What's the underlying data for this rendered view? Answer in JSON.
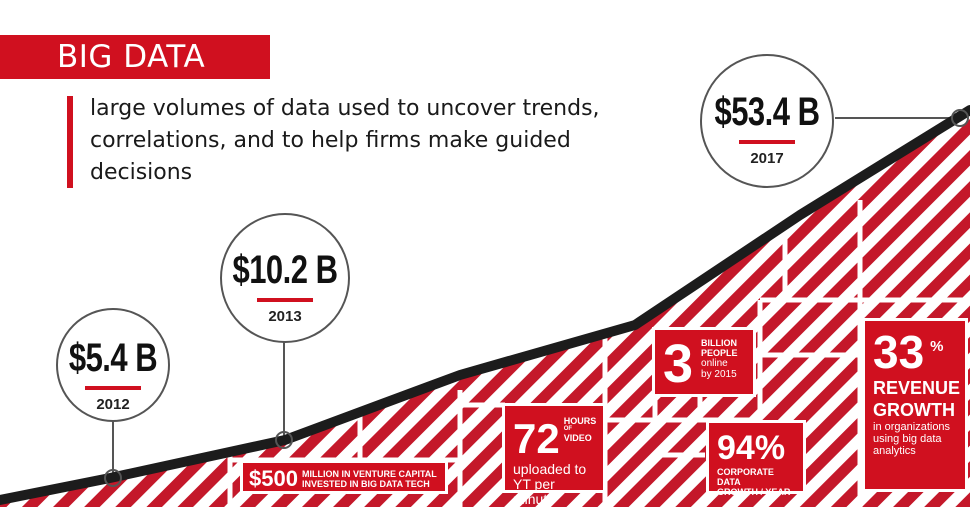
{
  "header": {
    "title": "BIG DATA",
    "description": "large volumes of data used to uncover trends, correlations, and to help firms make guided decisions"
  },
  "milestones": [
    {
      "value": "$5.4 B",
      "year": "2012"
    },
    {
      "value": "$10.2 B",
      "year": "2013"
    },
    {
      "value": "$53.4 B",
      "year": "2017"
    }
  ],
  "facts": {
    "vc": {
      "number": "$500",
      "line1": "MILLION IN VENTURE CAPITAL",
      "line2": "INVESTED IN BIG DATA TECH"
    },
    "video": {
      "number": "72",
      "unit1": "HOURS",
      "unit2": "OF",
      "unit3": "VIDEO",
      "text1": "uploaded to",
      "text2": "YT per minute"
    },
    "people": {
      "number": "3",
      "label1": "BILLION",
      "label2": "PEOPLE",
      "text1": "online",
      "text2": "by 2015"
    },
    "growth": {
      "number": "94%",
      "line1": "CORPORATE DATA",
      "line2": "GROWTH / YEAR"
    },
    "revenue": {
      "number": "33",
      "unit": "%",
      "label1": "REVENUE",
      "label2": "GROWTH",
      "text1": "in organizations",
      "text2": "using big data",
      "text3": "analytics"
    }
  },
  "colors": {
    "accent": "#d0101f",
    "line": "#1c1c1c",
    "connector": "#555555"
  }
}
